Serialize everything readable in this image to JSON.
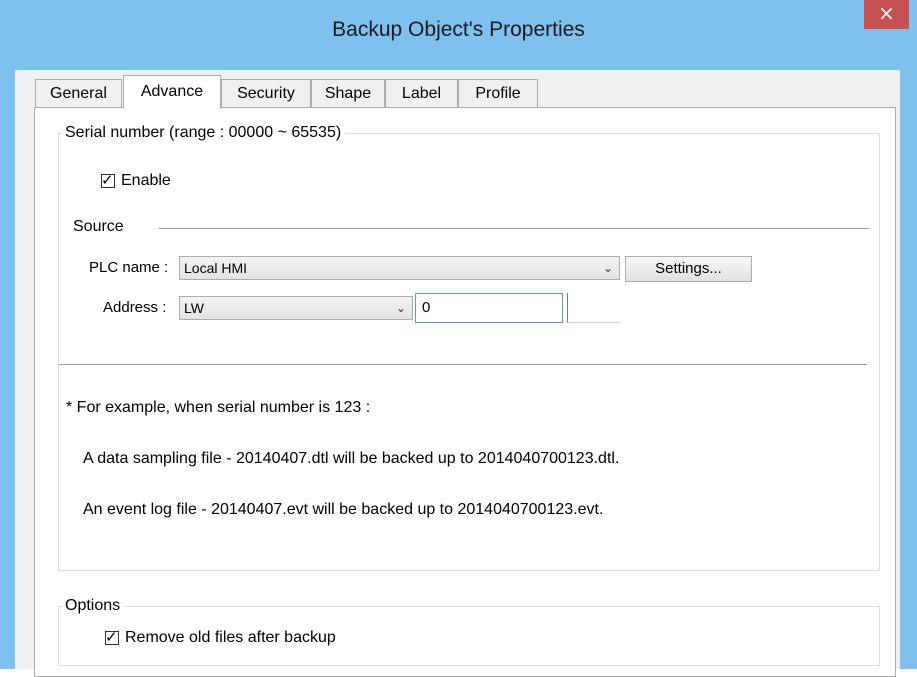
{
  "window": {
    "title": "Backup Object's Properties",
    "close_label": "×"
  },
  "tabs": [
    {
      "label": "General",
      "active": false
    },
    {
      "label": "Advance",
      "active": true
    },
    {
      "label": "Security",
      "active": false
    },
    {
      "label": "Shape",
      "active": false
    },
    {
      "label": "Label",
      "active": false
    },
    {
      "label": "Profile",
      "active": false
    }
  ],
  "serial": {
    "group_label": "Serial number (range : 00000 ~ 65535)",
    "enable_label": "Enable",
    "enable_checked": true,
    "source_label": "Source",
    "plc_name_label": "PLC name :",
    "plc_name_value": "Local HMI",
    "settings_button": "Settings...",
    "address_label": "Address :",
    "address_device": "LW",
    "address_value": "0",
    "example_heading": "* For example, when serial number is 123 :",
    "example_line_1": "A data sampling file - 20140407.dtl will be backed up to 2014040700123.dtl.",
    "example_line_2": "An event log file - 20140407.evt will be backed up to 2014040700123.evt."
  },
  "options": {
    "group_label": "Options",
    "remove_old_label": "Remove old files after backup",
    "remove_old_checked": true
  },
  "icons": {
    "check": "✓",
    "dropdown": "⌄"
  },
  "colors": {
    "titlebar": "#7ec0ee",
    "close_button": "#c75050",
    "textbox_focus_border": "#569de5"
  }
}
